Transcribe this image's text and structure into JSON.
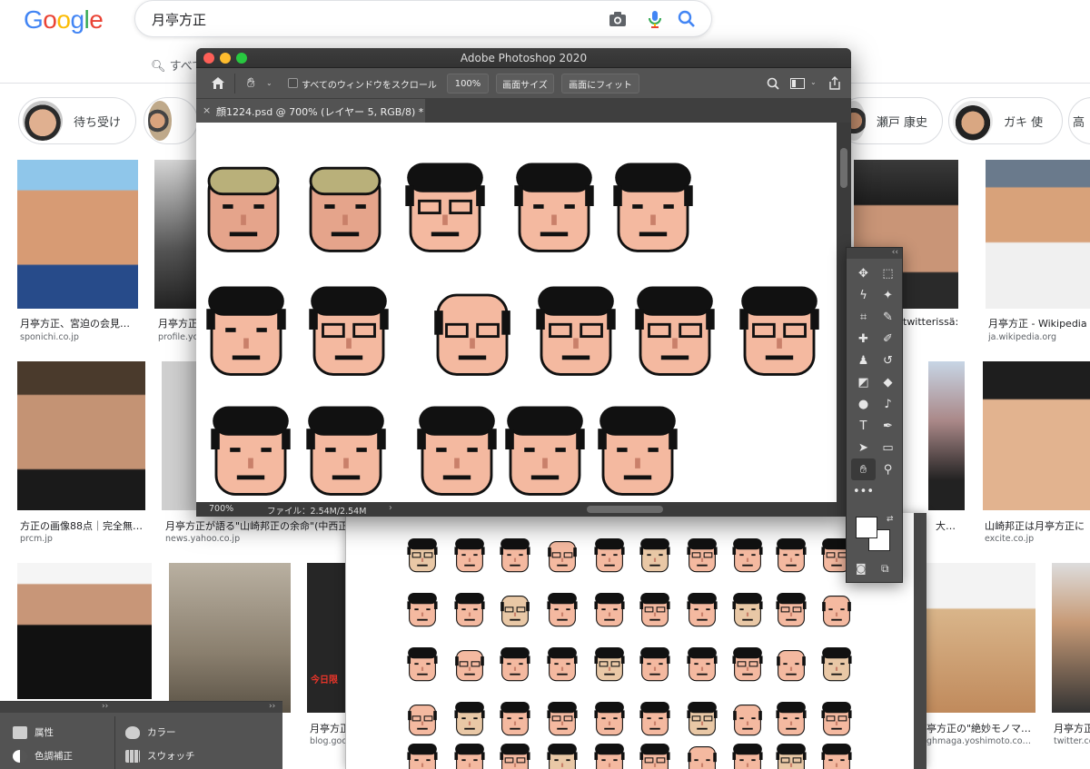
{
  "google": {
    "logo_letters": [
      "G",
      "o",
      "o",
      "g",
      "l",
      "e"
    ],
    "search_query": "月亭方正",
    "tab_label": "すべて",
    "chips": [
      {
        "label": "待ち受け"
      },
      {
        "label": "瀬戸 康史"
      },
      {
        "label": "ガキ 使"
      },
      {
        "label": "高"
      }
    ],
    "results": [
      {
        "caption": "月亭方正、宮迫の会見…",
        "source": "sponichi.co.jp"
      },
      {
        "caption": "月亭方正",
        "source": "profile.yo"
      },
      {
        "caption": "twitterissä: \"…",
        "source": ""
      },
      {
        "caption": "月亭方正 - Wikipedia",
        "source": "ja.wikipedia.org"
      },
      {
        "caption": "方正の画像88点｜完全無…",
        "source": "prcm.jp"
      },
      {
        "caption": "月亭方正が語る\"山崎邦正の余命\"(中西正",
        "source": "news.yahoo.co.jp"
      },
      {
        "caption": "大…",
        "source": ""
      },
      {
        "caption": "山崎邦正は月亭方正に",
        "source": "excite.co.jp"
      },
      {
        "caption": "月亭方正",
        "source": "blog.goo"
      },
      {
        "caption": "亭方正の\"絶妙モノマ…",
        "source": "ghmaga.yoshimoto.co…"
      },
      {
        "caption": "月亭方正",
        "source": "twitter.co"
      }
    ],
    "thumb_text": "今日限"
  },
  "photoshop": {
    "app_title": "Adobe Photoshop 2020",
    "scroll_all_windows_label": "すべてのウィンドウをスクロール",
    "zoom_button": "100%",
    "fit_screen_button": "画面サイズ",
    "fill_screen_button": "画面にフィット",
    "doc_tab": "顔1224.psd @ 700% (レイヤー 5, RGB/8) *",
    "status_zoom": "700%",
    "status_file": "ファイル：2.54M/2.54M",
    "tools_collapse": "‹‹",
    "tools_more": "•••"
  },
  "panels": {
    "collapse_label": "››",
    "left_items": [
      "属性",
      "色調補正"
    ],
    "right_items": [
      "カラー",
      "スウォッチ"
    ]
  }
}
